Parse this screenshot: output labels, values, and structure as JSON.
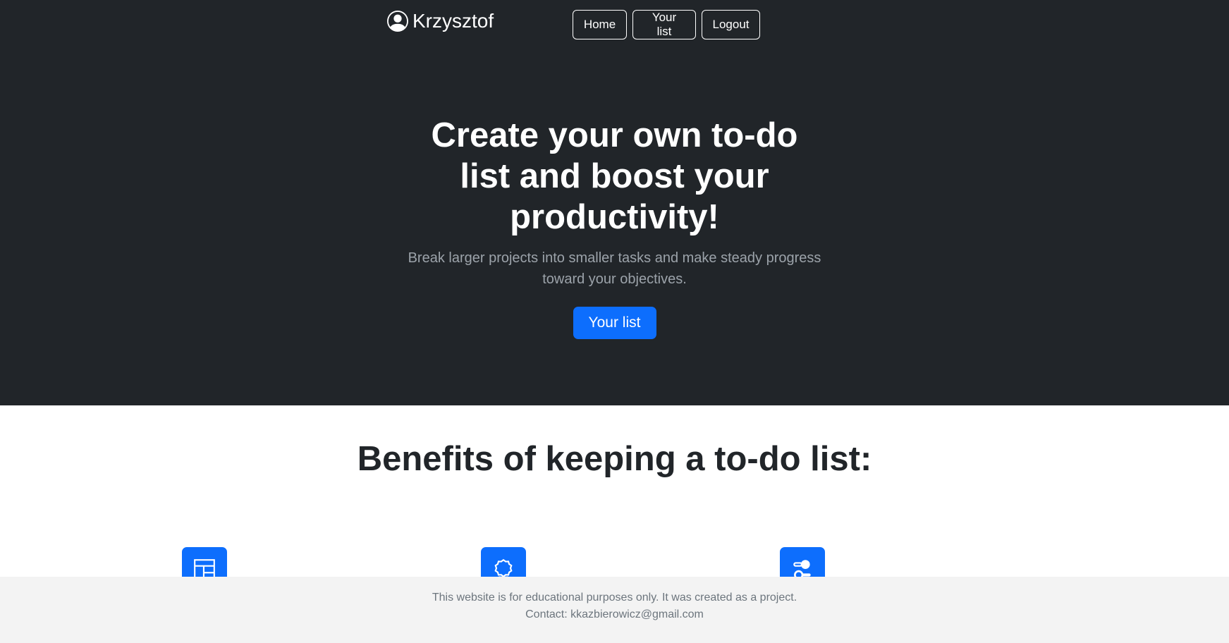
{
  "header": {
    "brand_icon": "person-circle-icon",
    "brand_name": "Krzysztof",
    "nav": {
      "home": "Home",
      "your_list": "Your list",
      "logout": "Logout"
    }
  },
  "hero": {
    "title": "Create your own to-do list and boost your productivity!",
    "subtitle": "Break larger projects into smaller tasks and make steady progress toward your objectives.",
    "cta": "Your list"
  },
  "benefits": {
    "title": "Benefits of keeping a to-do list:",
    "features": [
      {
        "icon": "layout-icon"
      },
      {
        "icon": "award-icon"
      },
      {
        "icon": "toggles-icon"
      }
    ]
  },
  "footer": {
    "line1": "This website is for educational purposes only. It was created as a project.",
    "line2": "Contact: kkazbierowicz@gmail.com"
  },
  "colors": {
    "dark_bg": "#212529",
    "primary": "#0d6efd",
    "footer_bg": "#f3f3f3",
    "muted_text": "#6c757d"
  }
}
